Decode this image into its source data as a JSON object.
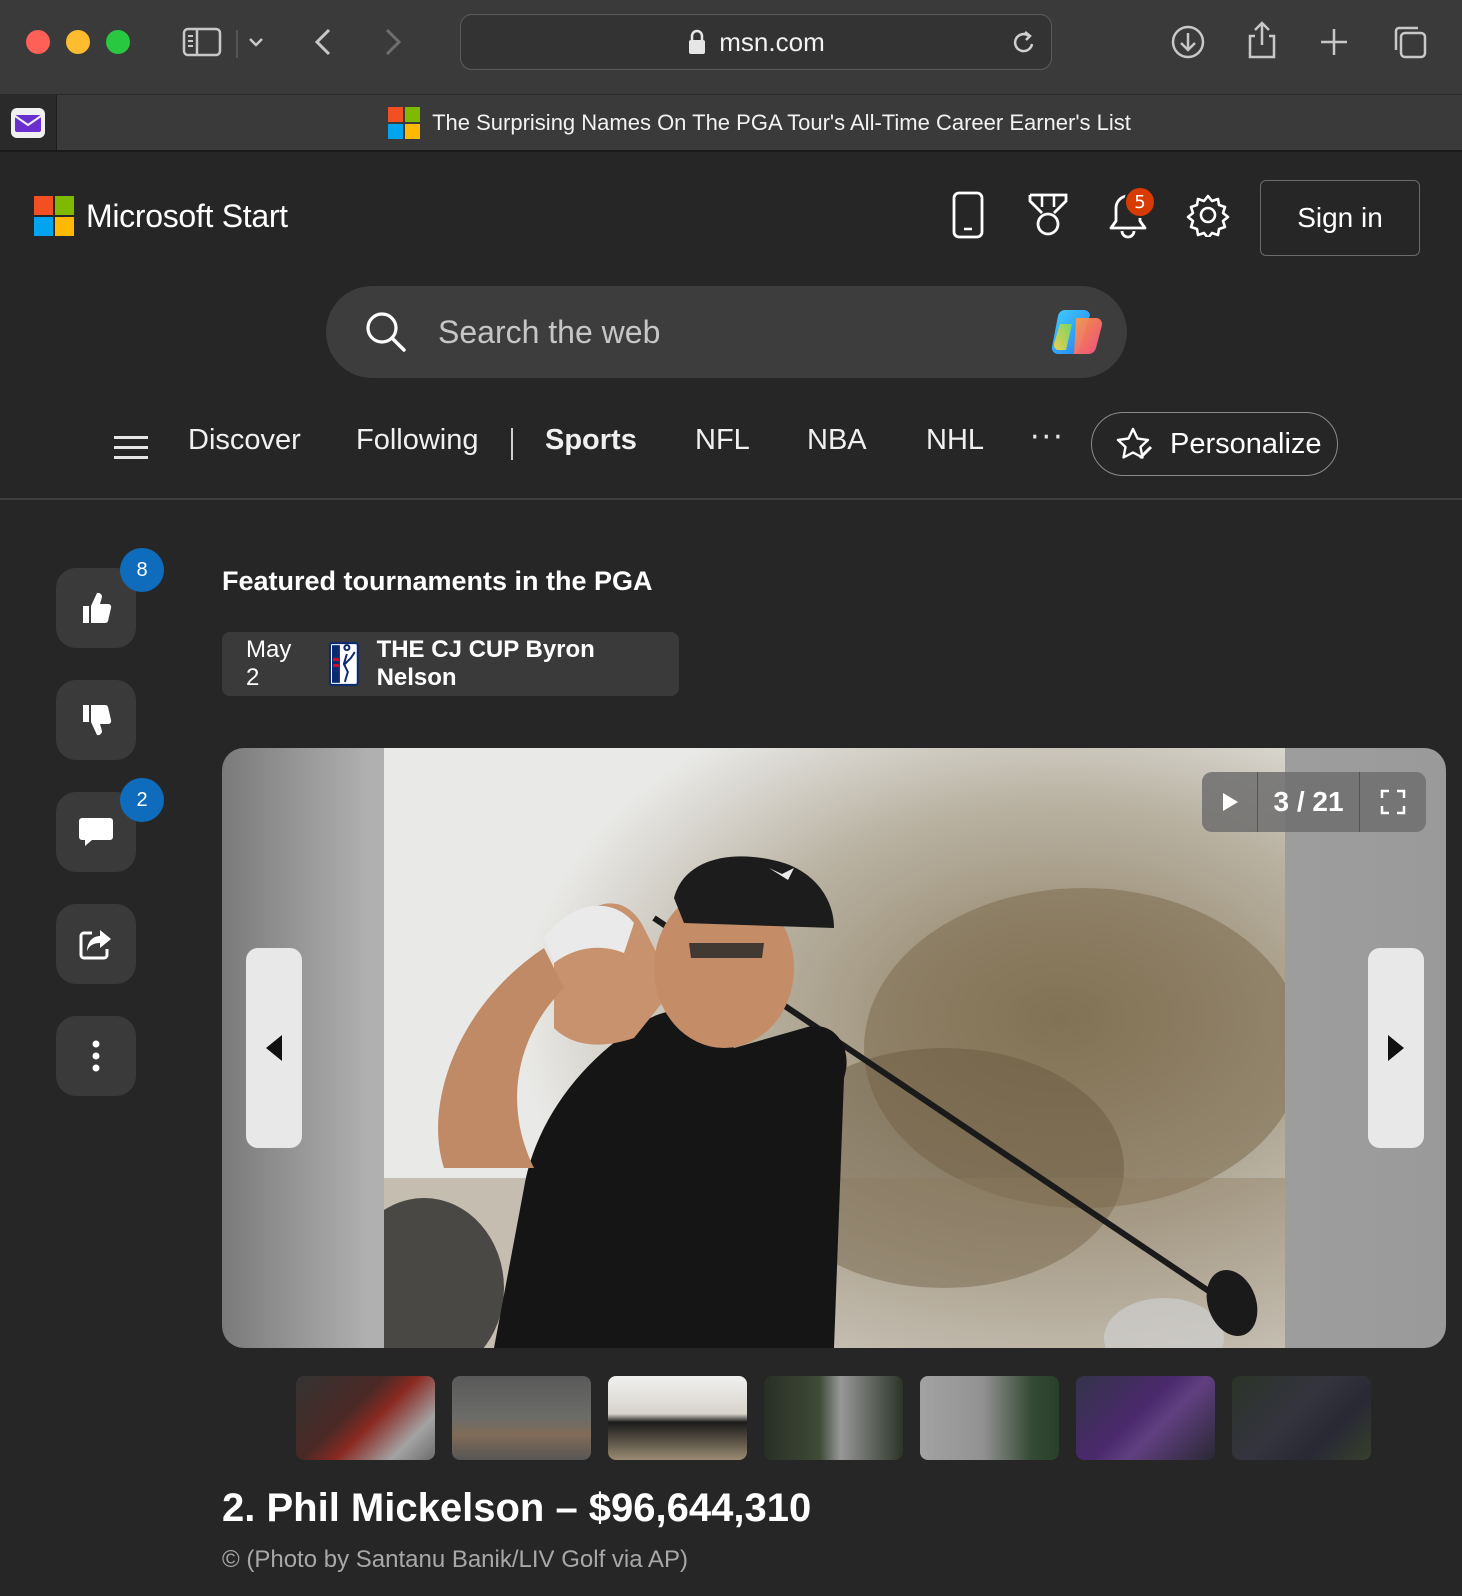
{
  "browser": {
    "url": "msn.com",
    "tab_title": "The Surprising Names On The PGA Tour's All-Time Career Earner's List"
  },
  "header": {
    "brand": "Microsoft Start",
    "notification_count": "5",
    "sign_in_label": "Sign in"
  },
  "search": {
    "placeholder": "Search the web"
  },
  "nav": {
    "items": [
      "Discover",
      "Following",
      "Sports",
      "NFL",
      "NBA",
      "NHL"
    ],
    "active": "Sports",
    "more_label": "···",
    "personalize_label": "Personalize"
  },
  "actions": {
    "likes": "8",
    "comments": "2"
  },
  "featured": {
    "title": "Featured tournaments in the PGA",
    "tournament_date": "May 2",
    "tournament_name": "THE CJ CUP Byron Nelson"
  },
  "slideshow": {
    "counter": "3 / 21",
    "current": 3,
    "total": 21,
    "title": "2. Phil Mickelson – $96,644,310",
    "credit": "© (Photo by Santanu Banik/LIV Golf via AP)"
  },
  "colors": {
    "accent_badge": "#0f6cbd",
    "notification_badge": "#d83b01",
    "background": "#262626"
  }
}
